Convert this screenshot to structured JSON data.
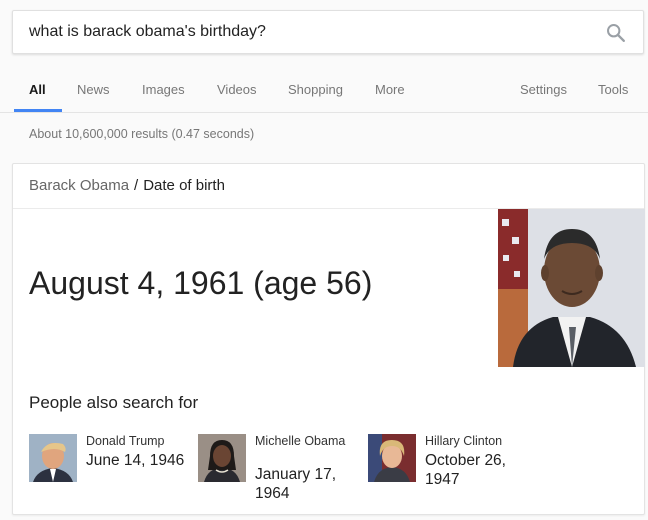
{
  "search": {
    "query": "what is barack obama's birthday?",
    "icon": "search-icon"
  },
  "tabs": [
    {
      "label": "All",
      "active": true
    },
    {
      "label": "News"
    },
    {
      "label": "Images"
    },
    {
      "label": "Videos"
    },
    {
      "label": "Shopping"
    },
    {
      "label": "More"
    },
    {
      "label": "Settings"
    },
    {
      "label": "Tools"
    }
  ],
  "results_stats": "About 10,600,000 results (0.47 seconds)",
  "card": {
    "breadcrumb_entity": "Barack Obama",
    "breadcrumb_separator": "/",
    "breadcrumb_attribute": "Date of birth",
    "answer": "August 4, 1961 (age 56)",
    "people_also_search_title": "People also search for",
    "people": [
      {
        "name": "Donald Trump",
        "date": "June 14, 1946"
      },
      {
        "name": "Michelle Obama",
        "date": "January 17, 1964"
      },
      {
        "name": "Hillary Clinton",
        "date": "October 26, 1947"
      }
    ]
  },
  "colors": {
    "accent_blue": "#4285f4",
    "muted_text": "#777777",
    "card_border": "#e3e3e3"
  }
}
